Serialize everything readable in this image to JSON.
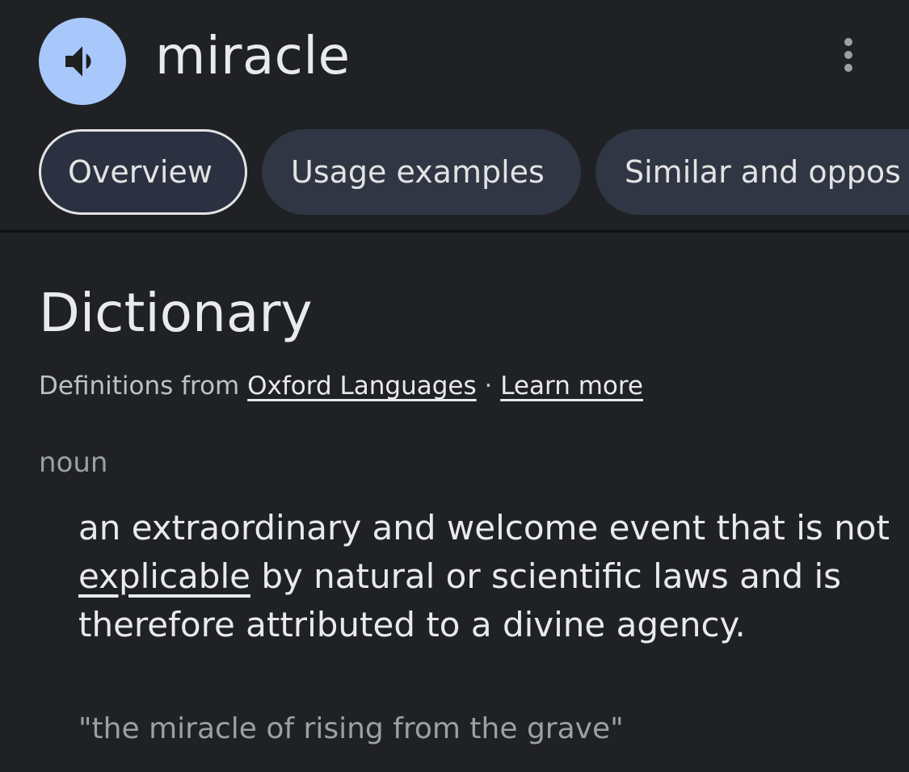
{
  "header": {
    "word": "miracle",
    "speaker_icon": "volume-up-icon",
    "more_icon": "more-vert-icon"
  },
  "tabs": [
    {
      "label": "Overview",
      "active": true
    },
    {
      "label": "Usage examples",
      "active": false
    },
    {
      "label": "Similar and oppos",
      "active": false
    }
  ],
  "dictionary": {
    "title": "Dictionary",
    "source_prefix": "Definitions from",
    "source_link": "Oxford Languages",
    "separator": "·",
    "learn_more": "Learn more",
    "part_of_speech": "noun",
    "definition_part1": "an extraordinary and welcome event that is not",
    "definition_link": "explicable",
    "definition_part2": "by natural or scientific laws and is therefore attributed to a divine agency.",
    "example": "\"the miracle of rising from the grave\""
  },
  "colors": {
    "background": "#202124",
    "accent": "#a8c7fa",
    "tab_bg": "#303644",
    "text_primary": "#e8eaed",
    "text_secondary": "#9aa0a6"
  }
}
